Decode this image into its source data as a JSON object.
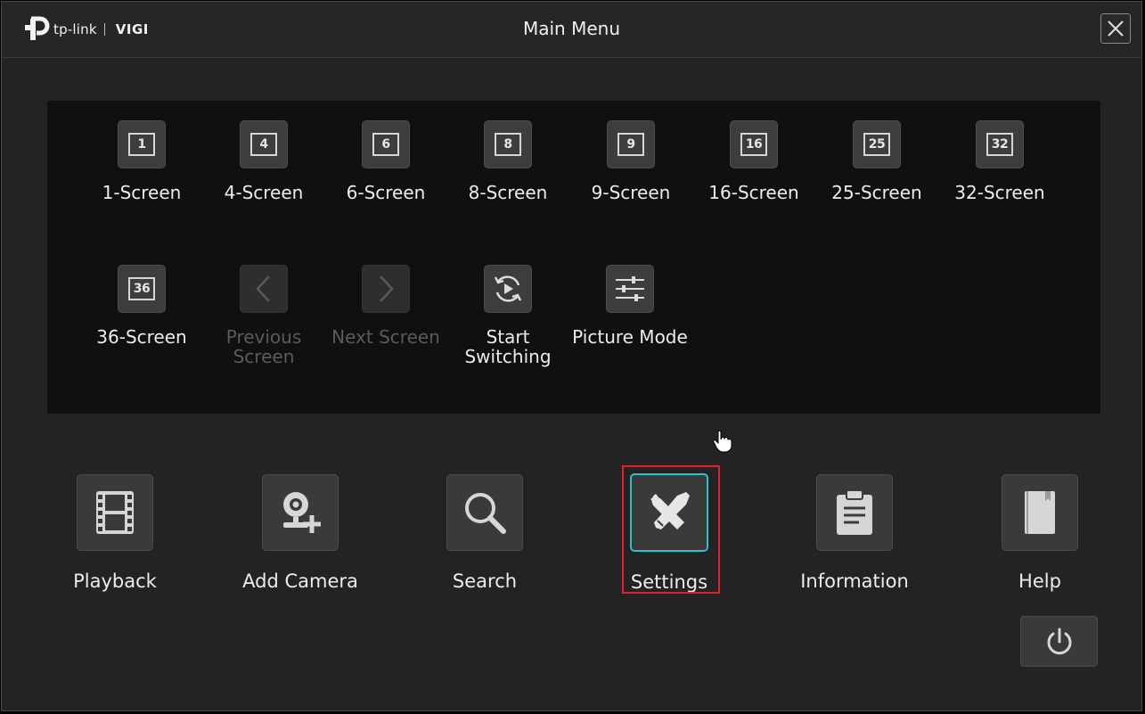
{
  "header": {
    "brand": "tp-link",
    "brand_product": "VIGI",
    "title": "Main Menu"
  },
  "layout_tiles": [
    {
      "label": "1-Screen",
      "icon": "1",
      "enabled": true
    },
    {
      "label": "4-Screen",
      "icon": "4",
      "enabled": true
    },
    {
      "label": "6-Screen",
      "icon": "6",
      "enabled": true
    },
    {
      "label": "8-Screen",
      "icon": "8",
      "enabled": true
    },
    {
      "label": "9-Screen",
      "icon": "9",
      "enabled": true
    },
    {
      "label": "16-Screen",
      "icon": "16",
      "enabled": true
    },
    {
      "label": "25-Screen",
      "icon": "25",
      "enabled": true
    },
    {
      "label": "32-Screen",
      "icon": "32",
      "enabled": true
    },
    {
      "label": "36-Screen",
      "icon": "36",
      "enabled": true
    },
    {
      "label": "Previous Screen",
      "icon": "chevron-left-icon",
      "enabled": false
    },
    {
      "label": "Next Screen",
      "icon": "chevron-right-icon",
      "enabled": false
    },
    {
      "label": "Start Switching",
      "icon": "cycle-play-icon",
      "enabled": true
    },
    {
      "label": "Picture Mode",
      "icon": "sliders-icon",
      "enabled": true
    }
  ],
  "main_menu": [
    {
      "label": "Playback",
      "icon": "film-icon"
    },
    {
      "label": "Add Camera",
      "icon": "camera-add-icon"
    },
    {
      "label": "Search",
      "icon": "search-icon"
    },
    {
      "label": "Settings",
      "icon": "tools-icon",
      "selected": true
    },
    {
      "label": "Information",
      "icon": "clipboard-icon"
    },
    {
      "label": "Help",
      "icon": "book-icon"
    }
  ],
  "colors": {
    "accent": "#2fc0c6",
    "highlight": "#e0202a",
    "background": "#232323"
  }
}
